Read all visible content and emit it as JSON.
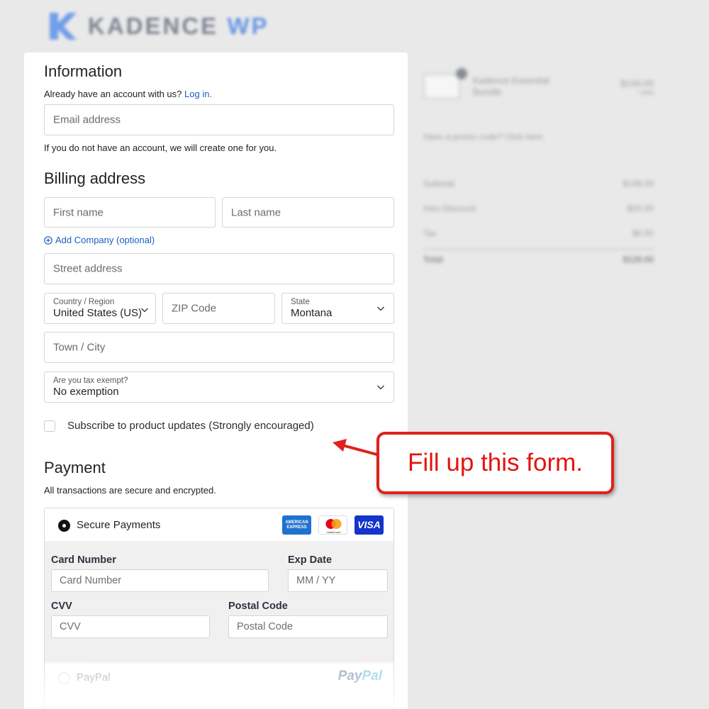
{
  "header": {
    "logo_text_a": "KADENCE",
    "logo_text_b": "WP"
  },
  "information": {
    "title": "Information",
    "account_prompt": "Already have an account with us?",
    "login_link": "Log in.",
    "email_placeholder": "Email address",
    "account_note": "If you do not have an account, we will create one for you."
  },
  "billing": {
    "title": "Billing address",
    "first_name_placeholder": "First name",
    "last_name_placeholder": "Last name",
    "add_company": "Add Company (optional)",
    "street_placeholder": "Street address",
    "country_label": "Country / Region",
    "country_value": "United States (US)",
    "zip_placeholder": "ZIP Code",
    "state_label": "State",
    "state_value": "Montana",
    "town_placeholder": "Town / City",
    "tax_label": "Are you tax exempt?",
    "tax_value": "No exemption",
    "subscribe_label": "Subscribe to product updates (Strongly encouraged)",
    "subscribe_checked": false
  },
  "payment": {
    "title": "Payment",
    "note": "All transactions are secure and encrypted.",
    "secure_label": "Secure Payments",
    "card_logos": [
      "AMERICAN EXPRESS",
      "mastercard",
      "VISA"
    ],
    "card_number_label": "Card Number",
    "card_number_placeholder": "Card Number",
    "exp_label": "Exp Date",
    "exp_placeholder": "MM / YY",
    "cvv_label": "CVV",
    "cvv_placeholder": "CVV",
    "postal_label": "Postal Code",
    "postal_placeholder": "Postal Code",
    "paypal_label": "PayPal",
    "paypal_logo_a": "Pay",
    "paypal_logo_b": "Pal"
  },
  "summary": {
    "product_name": "Kadence Essential Bundle",
    "product_price": "$149.00",
    "product_period": "/ year",
    "promo": "Have a promo code? Click here.",
    "rows": [
      {
        "label": "Subtotal",
        "value": "$149.00"
      },
      {
        "label": "Intro Discount",
        "value": "-$20.00"
      },
      {
        "label": "Tax",
        "value": "$0.00"
      }
    ],
    "total_label": "Total",
    "total_value": "$129.00"
  },
  "annotation": {
    "text": "Fill up this form.",
    "color": "#e3140f"
  },
  "colors": {
    "link": "#1a60c2",
    "background": "#e9e9ea",
    "callout_border": "#e0211b"
  }
}
